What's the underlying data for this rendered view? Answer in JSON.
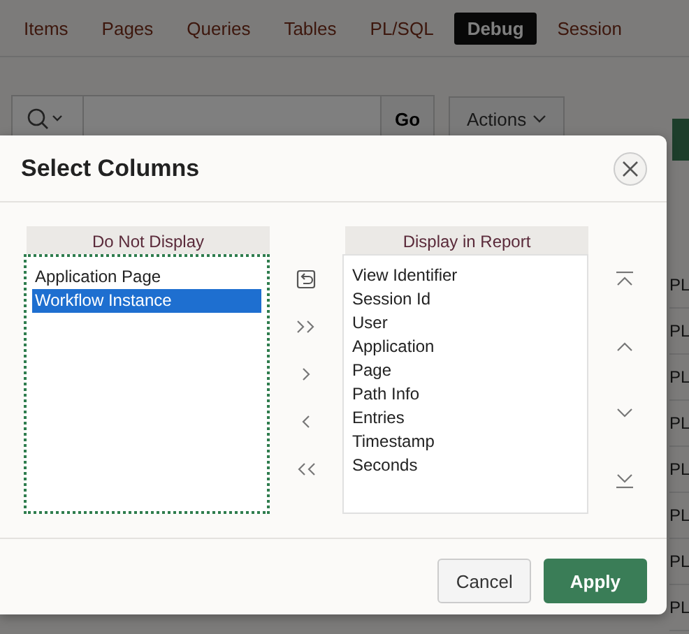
{
  "background": {
    "tabs": [
      {
        "label": "Items",
        "selected": false
      },
      {
        "label": "Pages",
        "selected": false
      },
      {
        "label": "Queries",
        "selected": false
      },
      {
        "label": "Tables",
        "selected": false
      },
      {
        "label": "PL/SQL",
        "selected": false
      },
      {
        "label": "Debug",
        "selected": true
      },
      {
        "label": "Session",
        "selected": false
      }
    ],
    "toolbar": {
      "go_button": "Go",
      "actions_button": "Actions"
    },
    "report_cells": [
      "PL",
      "PL",
      "PL",
      "PL",
      "PL",
      "PL",
      "PL",
      "PL"
    ]
  },
  "dialog": {
    "title": "Select Columns",
    "lists": [
      {
        "heading": "Do Not Display",
        "focused": true,
        "items": [
          {
            "label": "Application Page",
            "selected": false
          },
          {
            "label": "Workflow Instance",
            "selected": true
          }
        ]
      },
      {
        "heading": "Display in Report",
        "focused": false,
        "items": [
          {
            "label": "View Identifier",
            "selected": false
          },
          {
            "label": "Session Id",
            "selected": false
          },
          {
            "label": "User",
            "selected": false
          },
          {
            "label": "Application",
            "selected": false
          },
          {
            "label": "Page",
            "selected": false
          },
          {
            "label": "Path Info",
            "selected": false
          },
          {
            "label": "Entries",
            "selected": false
          },
          {
            "label": "Timestamp",
            "selected": false
          },
          {
            "label": "Seconds",
            "selected": false
          }
        ]
      }
    ],
    "buttons": [
      {
        "label": "Cancel",
        "kind": "secondary"
      },
      {
        "label": "Apply",
        "kind": "primary"
      }
    ]
  }
}
